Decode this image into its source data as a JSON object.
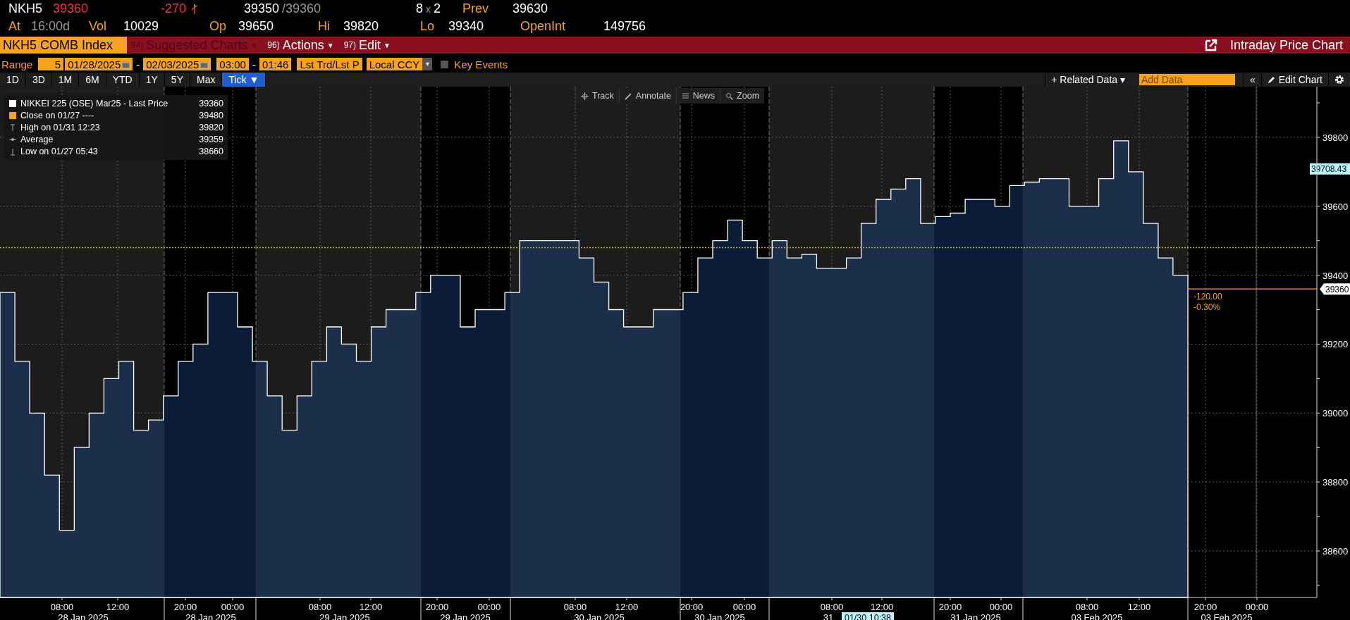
{
  "quote": {
    "ticker": "NKH5",
    "last": "39360",
    "change": "-270",
    "bid": "39350",
    "ask": "/39360",
    "size_bid": "8",
    "size_sep": "x",
    "size_ask": "2",
    "prev_label": "Prev",
    "prev": "39630",
    "fields": [
      {
        "label": "At",
        "value": "16:00d",
        "muted": true
      },
      {
        "label": "Vol",
        "value": "10029",
        "muted": false
      },
      {
        "label": "Op",
        "value": "39650",
        "muted": false
      },
      {
        "label": "Hi",
        "value": "39820",
        "muted": false
      },
      {
        "label": "Lo",
        "value": "39340",
        "muted": false
      },
      {
        "label": "OpenInt",
        "value": "149756",
        "muted": false
      }
    ]
  },
  "command_bar": {
    "security": "NKH5 COMB Index",
    "menus": [
      {
        "number": "94)",
        "label": "Suggested Charts",
        "caret": "▼",
        "disabled": true
      },
      {
        "number": "96)",
        "label": "Actions",
        "caret": "▼",
        "disabled": false
      },
      {
        "number": "97)",
        "label": "Edit",
        "caret": "▼",
        "disabled": false
      }
    ],
    "title": "Intraday Price Chart"
  },
  "range_bar": {
    "label": "Range",
    "days": "5",
    "start_date": "01/28/2025",
    "dash1": "-",
    "end_date": "02/03/2025",
    "start_time": "03:00",
    "dash2": "-",
    "end_time": "01:46",
    "pricing": "Lst Trd/Lst P",
    "currency": "Local CCY",
    "currency_caret": "▼",
    "key_events": {
      "label": "Key Events",
      "checked": false
    }
  },
  "periods": [
    {
      "label": "1D",
      "selected": false
    },
    {
      "label": "3D",
      "selected": false
    },
    {
      "label": "1M",
      "selected": false
    },
    {
      "label": "6M",
      "selected": false
    },
    {
      "label": "YTD",
      "selected": false
    },
    {
      "label": "1Y",
      "selected": false
    },
    {
      "label": "5Y",
      "selected": false
    },
    {
      "label": "Max",
      "selected": false
    },
    {
      "label": "Tick ▼",
      "selected": true
    }
  ],
  "chart_toolbar": {
    "related_data": "+ Related Data ▾",
    "add_data_placeholder": "Add Data",
    "collapse": "«",
    "edit_chart": "Edit Chart"
  },
  "chart_tools": [
    "Track",
    "Annotate",
    "News",
    "Zoom"
  ],
  "legend": [
    {
      "kind": "last",
      "label": "NIKKEI 225 (OSE) Mar25 - Last Price",
      "value": "39360"
    },
    {
      "kind": "close",
      "label": "Close on 01/27 ----",
      "value": "39480"
    },
    {
      "kind": "high",
      "label": "High on 01/31 12:23",
      "value": "39820"
    },
    {
      "kind": "average",
      "label": "Average",
      "value": "39359"
    },
    {
      "kind": "low",
      "label": "Low on 01/27 05:43",
      "value": "38660"
    }
  ],
  "chart": {
    "chart_data": {
      "type": "area",
      "grid": true,
      "ylim": [
        38465,
        39947
      ],
      "yticks": [
        38600,
        38800,
        39000,
        39200,
        39400,
        39600,
        39800
      ],
      "series": [
        {
          "color": "#ffffff",
          "values": [
            39350,
            39150,
            39000,
            38820,
            38660,
            38900,
            39000,
            39100,
            39150,
            38950,
            38980,
            39050,
            39150,
            39200,
            39350,
            39350,
            39250,
            39150,
            39050,
            38950,
            39050,
            39150,
            39250,
            39200,
            39150,
            39250,
            39300,
            39300,
            39350,
            39400,
            39400,
            39250,
            39300,
            39300,
            39350,
            39500,
            39500,
            39500,
            39500,
            39450,
            39380,
            39300,
            39250,
            39250,
            39300,
            39300,
            39350,
            39450,
            39500,
            39560,
            39500,
            39450,
            39500,
            39450,
            39460,
            39420,
            39420,
            39450,
            39550,
            39620,
            39650,
            39680,
            39550,
            39570,
            39580,
            39620,
            39620,
            39600,
            39660,
            39670,
            39680,
            39680,
            39600,
            39600,
            39680,
            39790,
            39700,
            39550,
            39450,
            39400,
            39360
          ]
        }
      ]
    },
    "price_tags": {
      "last": "39360",
      "change": "-120.00",
      "percent": "-0.30%",
      "marker": "39708.43"
    },
    "x_axis": {
      "groups": [
        {
          "times": [
            "08:00",
            "12:00"
          ],
          "date": "28 Jan 2025"
        },
        {
          "times": [
            "20:00",
            "00:00"
          ],
          "date": "28 Jan 2025"
        },
        {
          "times": [
            "08:00",
            "12:00"
          ],
          "date": "29 Jan 2025"
        },
        {
          "times": [
            "20:00",
            "00:00"
          ],
          "date": "29 Jan 2025"
        },
        {
          "times": [
            "08:00",
            "12:00"
          ],
          "date": "30 Jan 2025"
        },
        {
          "times": [
            "20:00",
            "00:00"
          ],
          "date": "30 Jan 2025"
        },
        {
          "times": [
            "08:00",
            "12:00"
          ],
          "date": "31"
        },
        {
          "times": [
            "20:00",
            "00:00"
          ],
          "date": "31 Jan 2025"
        },
        {
          "times": [
            "08:00",
            "12:00"
          ],
          "date": "03 Feb 2025"
        },
        {
          "times": [
            "20:00",
            "00:00"
          ],
          "date": "03 Feb 2025"
        }
      ],
      "cursor_time": "01/30 10:38"
    }
  }
}
